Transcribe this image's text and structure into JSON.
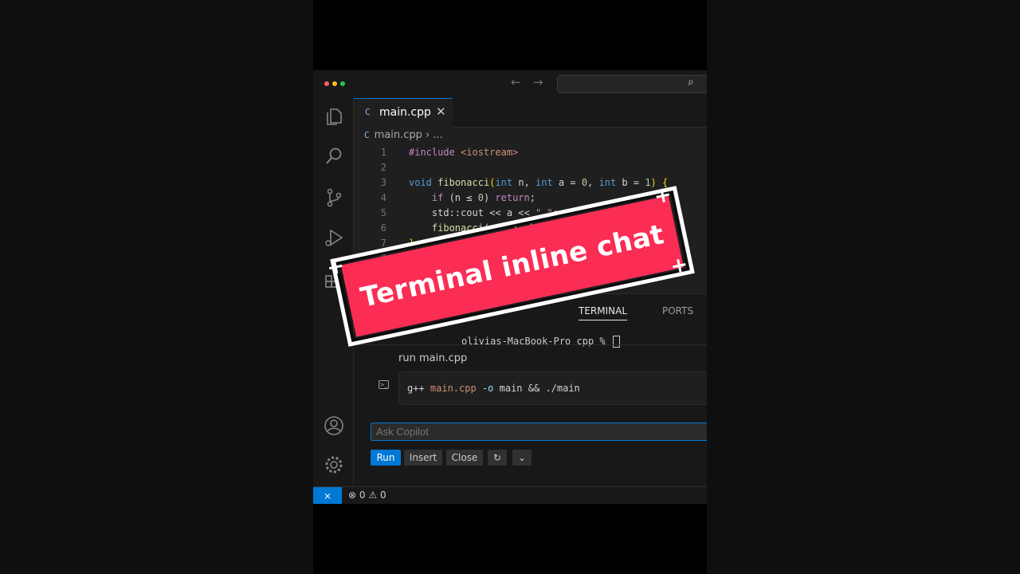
{
  "editor": {
    "tab_label": "main.cpp",
    "close_glyph": "✕",
    "file_badge": "C",
    "breadcrumb_file": "main.cpp",
    "breadcrumb_sep": "›",
    "breadcrumb_more": "..."
  },
  "code": [
    {
      "n": "1",
      "text": "#include <iostream>"
    },
    {
      "n": "2",
      "text": ""
    },
    {
      "n": "3",
      "text": "void fibonacci(int n, int a = 0, int b = 1) {"
    },
    {
      "n": "4",
      "text": "    if (n ≤ 0) return;"
    },
    {
      "n": "5",
      "text": "    std::cout << a << \" \";"
    },
    {
      "n": "6",
      "text": "    fibonacci(n - 1, b, a + b);"
    },
    {
      "n": "7",
      "text": "}"
    },
    {
      "n": "8",
      "text": ""
    }
  ],
  "panel": {
    "tabs": [
      "TERMINAL",
      "PORTS"
    ],
    "active_tab": "TERMINAL",
    "prompt_text": "olivias-MacBook-Pro cpp % ",
    "request": "run main.cpp",
    "command": "g++ main.cpp -o main && ./main",
    "ask_placeholder": "Ask Copilot",
    "buttons": {
      "run": "Run",
      "insert": "Insert",
      "close": "Close",
      "rerun": "↻",
      "more": "⌄"
    }
  },
  "status": {
    "remote_icon": "remote-icon",
    "errors": "0",
    "warnings": "0"
  },
  "overlay": {
    "caption": "Terminal inline chat",
    "fill_color": "#fb2d55"
  },
  "colors": {
    "accent": "#0078d4",
    "breakpoint": "#e51400"
  }
}
